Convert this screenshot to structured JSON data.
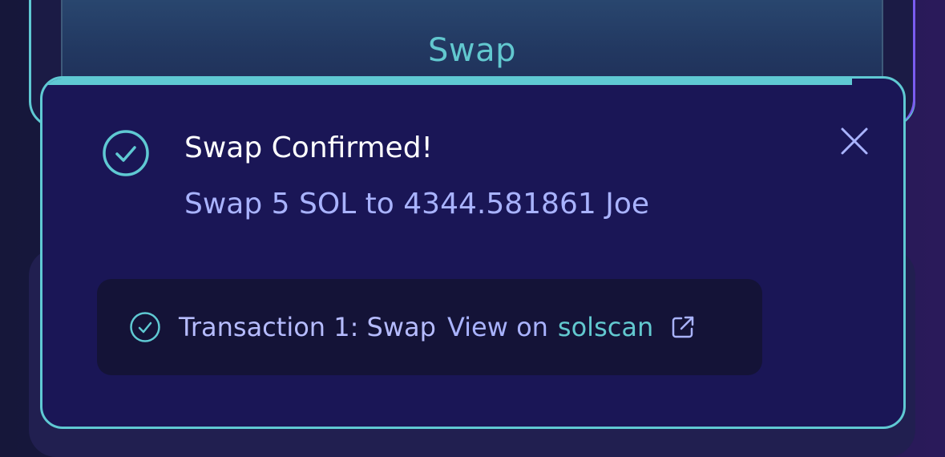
{
  "swap_button": {
    "label": "Swap"
  },
  "toast": {
    "title": "Swap Confirmed!",
    "message": "Swap 5 SOL to 4344.581861 Joe",
    "progress": 0.94,
    "transaction": {
      "label": "Transaction 1: Swap",
      "view_prefix": "View on",
      "link_label": "solscan"
    }
  },
  "colors": {
    "accent": "#5fc9d3",
    "toast_bg": "#1a1656",
    "text_secondary": "#a9b3ff"
  },
  "icons": {
    "status": "check-circle-icon",
    "close": "close-icon",
    "transaction_status": "check-circle-icon",
    "external": "external-link-icon"
  }
}
